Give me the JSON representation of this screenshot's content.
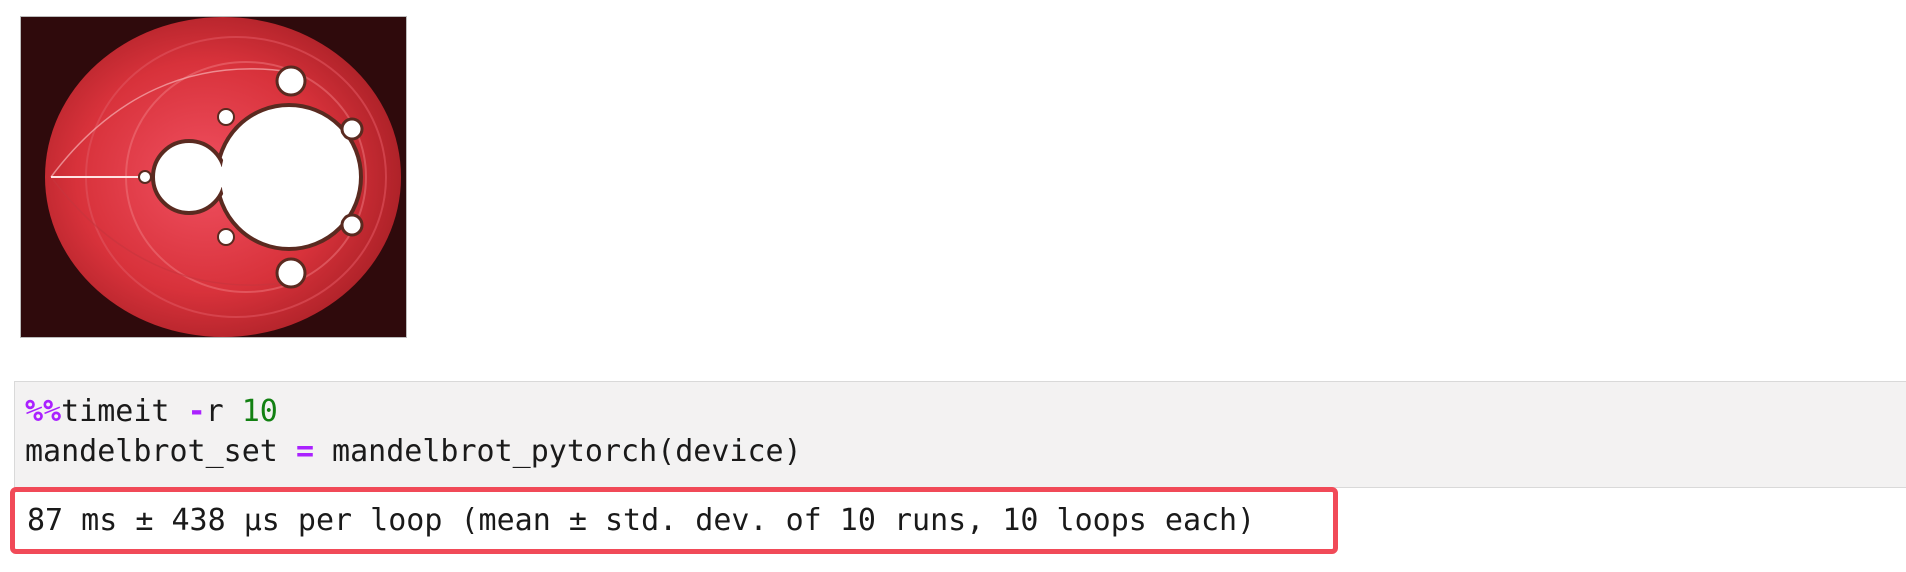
{
  "output_image": {
    "icon": "mandelbrot-fractal-image"
  },
  "code_cell": {
    "line1": {
      "magic": "%%",
      "command": "timeit ",
      "flag": "-",
      "flag_name": "r ",
      "number": "10"
    },
    "line2": {
      "variable": "mandelbrot_set ",
      "operator": "=",
      "expression": " mandelbrot_pytorch(device)"
    }
  },
  "output": {
    "text": "87 ms ± 438 µs per loop (mean ± std. dev. of 10 runs, 10 loops each)"
  },
  "colors": {
    "highlight_border": "#f14a58",
    "magic": "#aa22ff",
    "number": "#128012",
    "cell_background": "#f3f2f2"
  }
}
